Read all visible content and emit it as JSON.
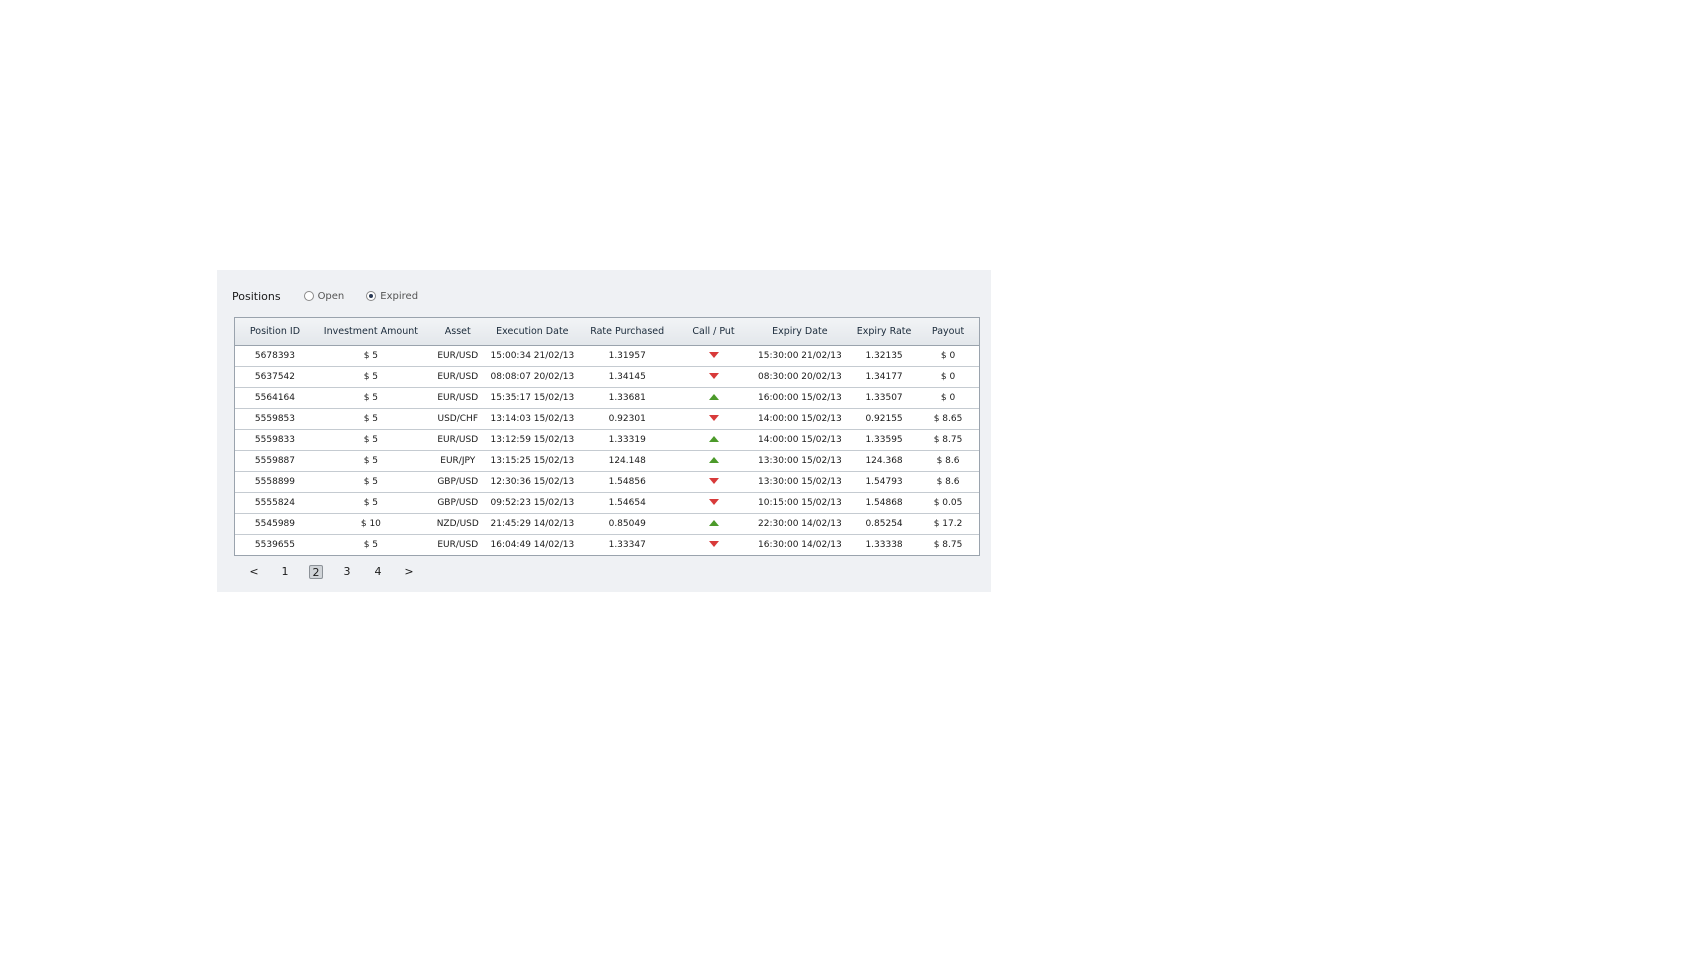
{
  "panel": {
    "title": "Positions",
    "filter": {
      "options": [
        {
          "label": "Open",
          "checked": false
        },
        {
          "label": "Expired",
          "checked": true
        }
      ]
    }
  },
  "table": {
    "columns": [
      "Position ID",
      "Investment Amount",
      "Asset",
      "Execution Date",
      "Rate Purchased",
      "Call / Put",
      "Expiry Date",
      "Expiry Rate",
      "Payout"
    ],
    "rows": [
      {
        "id": "5678393",
        "amount": "$ 5",
        "asset": "EUR/USD",
        "execution_date": "15:00:34 21/02/13",
        "rate_purchased": "1.31957",
        "direction": "down",
        "expiry_date": "15:30:00 21/02/13",
        "expiry_rate": "1.32135",
        "payout": "$ 0"
      },
      {
        "id": "5637542",
        "amount": "$ 5",
        "asset": "EUR/USD",
        "execution_date": "08:08:07 20/02/13",
        "rate_purchased": "1.34145",
        "direction": "down",
        "expiry_date": "08:30:00 20/02/13",
        "expiry_rate": "1.34177",
        "payout": "$ 0"
      },
      {
        "id": "5564164",
        "amount": "$ 5",
        "asset": "EUR/USD",
        "execution_date": "15:35:17 15/02/13",
        "rate_purchased": "1.33681",
        "direction": "up",
        "expiry_date": "16:00:00 15/02/13",
        "expiry_rate": "1.33507",
        "payout": "$ 0"
      },
      {
        "id": "5559853",
        "amount": "$ 5",
        "asset": "USD/CHF",
        "execution_date": "13:14:03 15/02/13",
        "rate_purchased": "0.92301",
        "direction": "down",
        "expiry_date": "14:00:00 15/02/13",
        "expiry_rate": "0.92155",
        "payout": "$ 8.65"
      },
      {
        "id": "5559833",
        "amount": "$ 5",
        "asset": "EUR/USD",
        "execution_date": "13:12:59 15/02/13",
        "rate_purchased": "1.33319",
        "direction": "up",
        "expiry_date": "14:00:00 15/02/13",
        "expiry_rate": "1.33595",
        "payout": "$ 8.75"
      },
      {
        "id": "5559887",
        "amount": "$ 5",
        "asset": "EUR/JPY",
        "execution_date": "13:15:25 15/02/13",
        "rate_purchased": "124.148",
        "direction": "up",
        "expiry_date": "13:30:00 15/02/13",
        "expiry_rate": "124.368",
        "payout": "$ 8.6"
      },
      {
        "id": "5558899",
        "amount": "$ 5",
        "asset": "GBP/USD",
        "execution_date": "12:30:36 15/02/13",
        "rate_purchased": "1.54856",
        "direction": "down",
        "expiry_date": "13:30:00 15/02/13",
        "expiry_rate": "1.54793",
        "payout": "$ 8.6"
      },
      {
        "id": "5555824",
        "amount": "$ 5",
        "asset": "GBP/USD",
        "execution_date": "09:52:23 15/02/13",
        "rate_purchased": "1.54654",
        "direction": "down",
        "expiry_date": "10:15:00 15/02/13",
        "expiry_rate": "1.54868",
        "payout": "$ 0.05"
      },
      {
        "id": "5545989",
        "amount": "$ 10",
        "asset": "NZD/USD",
        "execution_date": "21:45:29 14/02/13",
        "rate_purchased": "0.85049",
        "direction": "up",
        "expiry_date": "22:30:00 14/02/13",
        "expiry_rate": "0.85254",
        "payout": "$ 17.2"
      },
      {
        "id": "5539655",
        "amount": "$ 5",
        "asset": "EUR/USD",
        "execution_date": "16:04:49 14/02/13",
        "rate_purchased": "1.33347",
        "direction": "down",
        "expiry_date": "16:30:00 14/02/13",
        "expiry_rate": "1.33338",
        "payout": "$ 8.75"
      }
    ]
  },
  "pagination": {
    "prev": "<",
    "next": ">",
    "pages": [
      "1",
      "2",
      "3",
      "4"
    ],
    "current": "2"
  },
  "colors": {
    "panel_bg": "#eff1f4",
    "put_arrow": "#d83a3a",
    "call_arrow": "#4c9a2a"
  }
}
